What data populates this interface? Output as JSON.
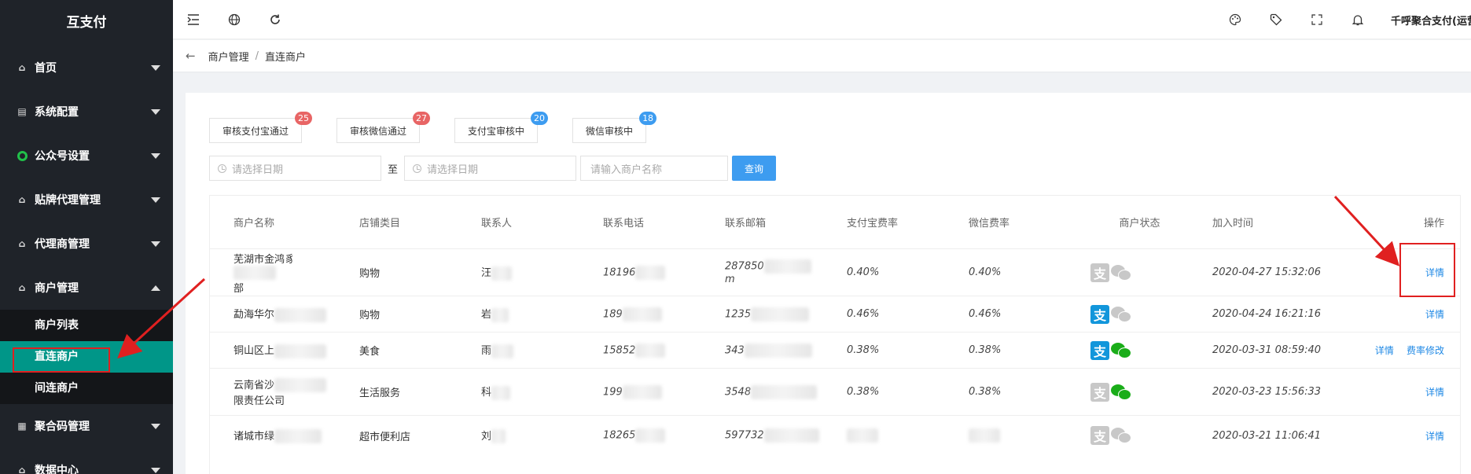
{
  "sidebar": {
    "logo": "互支付",
    "items": [
      {
        "label": "首页",
        "icon": "home-icon"
      },
      {
        "label": "系统配置",
        "icon": "config-icon"
      },
      {
        "label": "公众号设置",
        "icon": "circle-icon"
      },
      {
        "label": "贴牌代理管理",
        "icon": "home-icon"
      },
      {
        "label": "代理商管理",
        "icon": "home-icon"
      },
      {
        "label": "商户管理",
        "icon": "home-icon"
      },
      {
        "label": "聚合码管理",
        "icon": "grid-icon"
      },
      {
        "label": "数据中心",
        "icon": "home-icon"
      }
    ],
    "submenu": [
      {
        "label": "商户列表"
      },
      {
        "label": "直连商户"
      },
      {
        "label": "间连商户"
      }
    ]
  },
  "topbar": {
    "user": "千呼聚合支付(运营"
  },
  "breadcrumb": {
    "parent": "商户管理",
    "separator": "/",
    "current": "直连商户"
  },
  "tabs": [
    {
      "label": "审核支付宝通过",
      "count": "25",
      "color": "red"
    },
    {
      "label": "审核微信通过",
      "count": "27",
      "color": "red"
    },
    {
      "label": "支付宝审核中",
      "count": "20",
      "color": "blue"
    },
    {
      "label": "微信审核中",
      "count": "18",
      "color": "blue"
    }
  ],
  "filters": {
    "start_placeholder": "请选择日期",
    "to_label": "至",
    "end_placeholder": "请选择日期",
    "name_placeholder": "请输入商户名称",
    "query_label": "查询"
  },
  "table": {
    "headers": [
      "商户名称",
      "店铺类目",
      "联系人",
      "联系电话",
      "联系邮箱",
      "支付宝费率",
      "微信费率",
      "商户状态",
      "加入时间",
      "操作"
    ],
    "rows": [
      {
        "name1": "芜湖市金鸿豸",
        "name2": "部",
        "category": "购物",
        "contact": "汪",
        "phone": "18196",
        "email1": "287850",
        "email2": "m",
        "ali_rate": "0.40%",
        "wx_rate": "0.40%",
        "ali_on": false,
        "wx_on": false,
        "time": "2020-04-27 15:32:06",
        "action1": "详情",
        "action2": ""
      },
      {
        "name1": "勐海华尔",
        "name2": "",
        "category": "购物",
        "contact": "岩",
        "phone": "189",
        "email1": "1235",
        "email2": "",
        "ali_rate": "0.46%",
        "wx_rate": "0.46%",
        "ali_on": true,
        "wx_on": false,
        "time": "2020-04-24 16:21:16",
        "action1": "详情",
        "action2": ""
      },
      {
        "name1": "铜山区上",
        "name2": "",
        "category": "美食",
        "contact": "雨",
        "phone": "15852",
        "email1": "343",
        "email2": "",
        "ali_rate": "0.38%",
        "wx_rate": "0.38%",
        "ali_on": true,
        "wx_on": true,
        "time": "2020-03-31 08:59:40",
        "action1": "详情",
        "action2": "费率修改"
      },
      {
        "name1": "云南省沙",
        "name2": "限责任公司",
        "category": "生活服务",
        "contact": "科",
        "phone": "199",
        "email1": "3548",
        "email2": "",
        "ali_rate": "0.38%",
        "wx_rate": "0.38%",
        "ali_on": false,
        "wx_on": true,
        "time": "2020-03-23 15:56:33",
        "action1": "详情",
        "action2": ""
      },
      {
        "name1": "诸城市绿",
        "name2": "",
        "category": "超市便利店",
        "contact": "刘",
        "phone": "18265",
        "email1": "597732",
        "email2": "",
        "ali_rate": "",
        "wx_rate": "",
        "ali_on": false,
        "wx_on": false,
        "time": "2020-03-21 11:06:41",
        "action1": "详情",
        "action2": ""
      }
    ]
  },
  "colors": {
    "sidebar_bg": "#1f2329",
    "active_item": "#009688",
    "link": "#1e88e5",
    "primary": "#3d9cf0",
    "annotation": "#e02020"
  }
}
